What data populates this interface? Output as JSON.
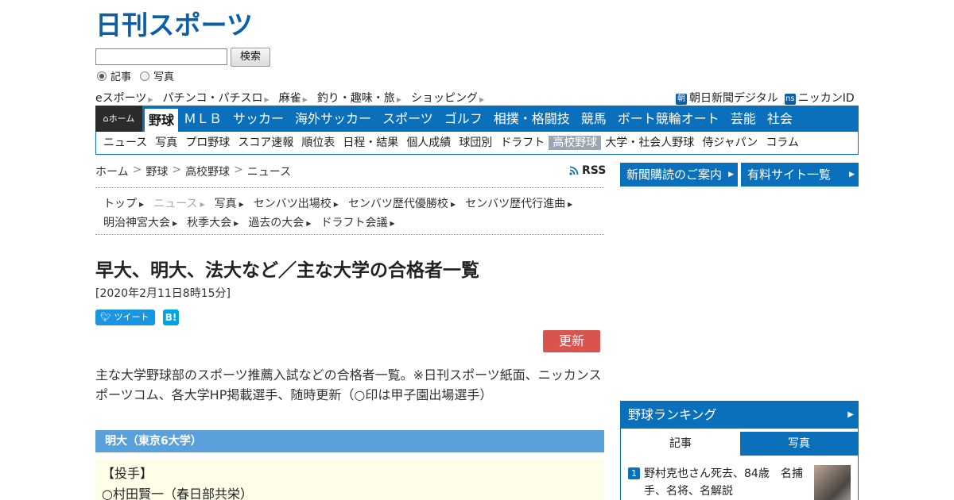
{
  "logo": {
    "text": "日刊スポーツ"
  },
  "search": {
    "value": "",
    "button_label": "検索",
    "options": [
      "記事",
      "写真"
    ],
    "selected": "記事"
  },
  "utility_links": [
    "eスポーツ",
    "パチンコ・パチスロ",
    "麻雀",
    "釣り・趣味・旅",
    "ショッピング"
  ],
  "account_links": [
    {
      "badge": "朝",
      "label": "朝日新聞デジタル"
    },
    {
      "badge": "ns",
      "label": "ニッカンID"
    }
  ],
  "nav_main": {
    "home_label": "ホーム",
    "items": [
      "野球",
      "ＭＬＢ",
      "サッカー",
      "海外サッカー",
      "スポーツ",
      "ゴルフ",
      "相撲・格闘技",
      "競馬",
      "ボート競輪オート",
      "芸能",
      "社会"
    ],
    "active": "野球"
  },
  "nav_sub": {
    "items": [
      "ニュース",
      "写真",
      "プロ野球",
      "スコア速報",
      "順位表",
      "日程・結果",
      "個人成績",
      "球団別",
      "ドラフト",
      "高校野球",
      "大学・社会人野球",
      "侍ジャパン",
      "コラム"
    ],
    "active": "高校野球"
  },
  "breadcrumb": [
    "ホーム",
    "野球",
    "高校野球",
    "ニュース"
  ],
  "rss_label": "RSS",
  "section_nav": {
    "row1": [
      "トップ",
      "ニュース",
      "写真",
      "センバツ出場校",
      "センバツ歴代優勝校",
      "センバツ歴代行進曲"
    ],
    "row2": [
      "明治神宮大会",
      "秋季大会",
      "過去の大会",
      "ドラフト会議"
    ],
    "current": "ニュース"
  },
  "article": {
    "title": "早大、明大、法大など／主な大学の合格者一覧",
    "date": "[2020年2月11日8時15分]",
    "tweet_label": "ツイート",
    "hatena_label": "B!",
    "update_label": "更新",
    "lead": "主な大学野球部のスポーツ推薦入試などの合格者一覧。※日刊スポーツ紙面、ニッカンスポーツコム、各大学HP掲載選手、随時更新（○印は甲子園出場選手）",
    "section_heading": "明大（東京6大学）",
    "section_lines": [
      "【投手】",
      "○村田賢一（春日部共栄）"
    ]
  },
  "sidebar": {
    "buttons": [
      "新聞購読のご案内",
      "有料サイト一覧"
    ],
    "ranking": {
      "heading": "野球ランキング",
      "tabs": [
        "記事",
        "写真"
      ],
      "active_tab": "記事",
      "items": [
        {
          "rank": "1",
          "text": "野村克也さん死去、84歳　名捕手、名将、名解説"
        }
      ]
    }
  },
  "colors": {
    "brand_blue": "#0b70bb",
    "home_dark": "#2b2b2b",
    "update_red": "#d9534f",
    "section_blue": "#5aa1dc",
    "section_bg": "#fdfde8"
  }
}
